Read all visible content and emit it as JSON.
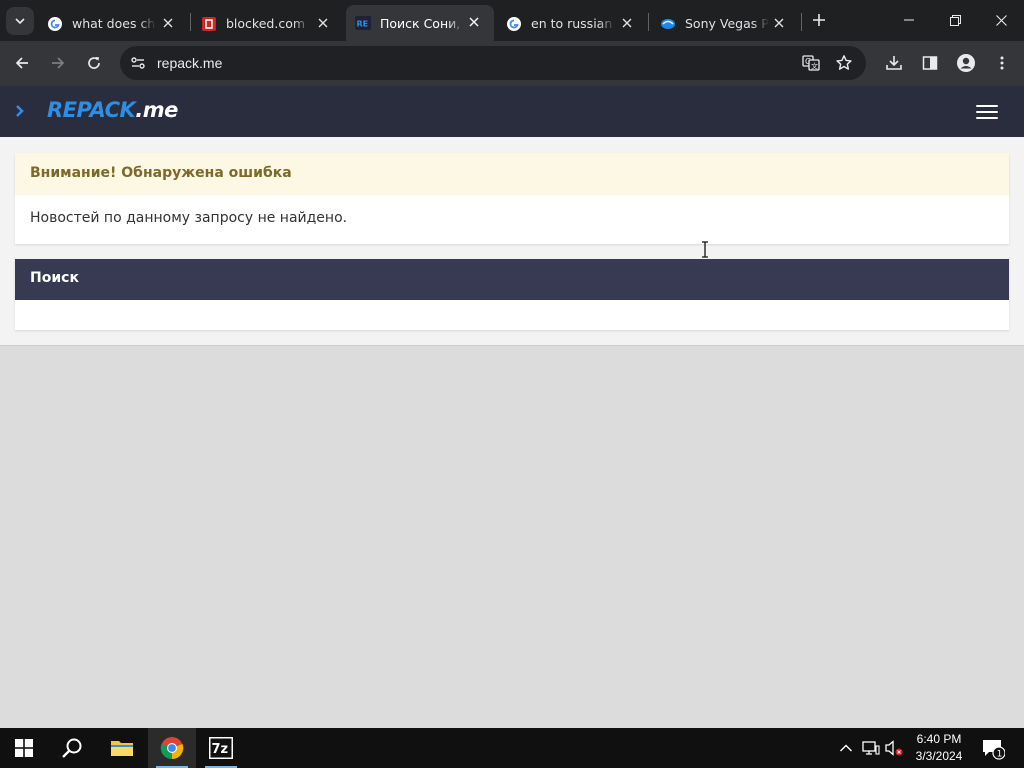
{
  "browser": {
    "tabs": [
      {
        "title": "what does chizi",
        "favicon": "google-icon",
        "active": false
      },
      {
        "title": "blocked.com",
        "favicon": "blocked-icon",
        "active": false
      },
      {
        "title": "Поиск Сони, на",
        "favicon": "repack-favicon",
        "active": true
      },
      {
        "title": "en to russian -",
        "favicon": "google-icon",
        "active": false
      },
      {
        "title": "Sony Vegas Pro",
        "favicon": "sony-icon",
        "active": false
      }
    ],
    "url": "repack.me"
  },
  "site": {
    "logo_brand": "REPACK",
    "logo_tld": ".me",
    "brand_color": "#2d8ee6",
    "header_color": "#292d3e"
  },
  "alert": {
    "title": "Внимание! Обнаружена ошибка",
    "message": "Новостей по данному запросу не найдено."
  },
  "search": {
    "heading": "Поиск"
  },
  "taskbar": {
    "time": "6:40 PM",
    "date": "3/3/2024",
    "notification_count": "1"
  }
}
